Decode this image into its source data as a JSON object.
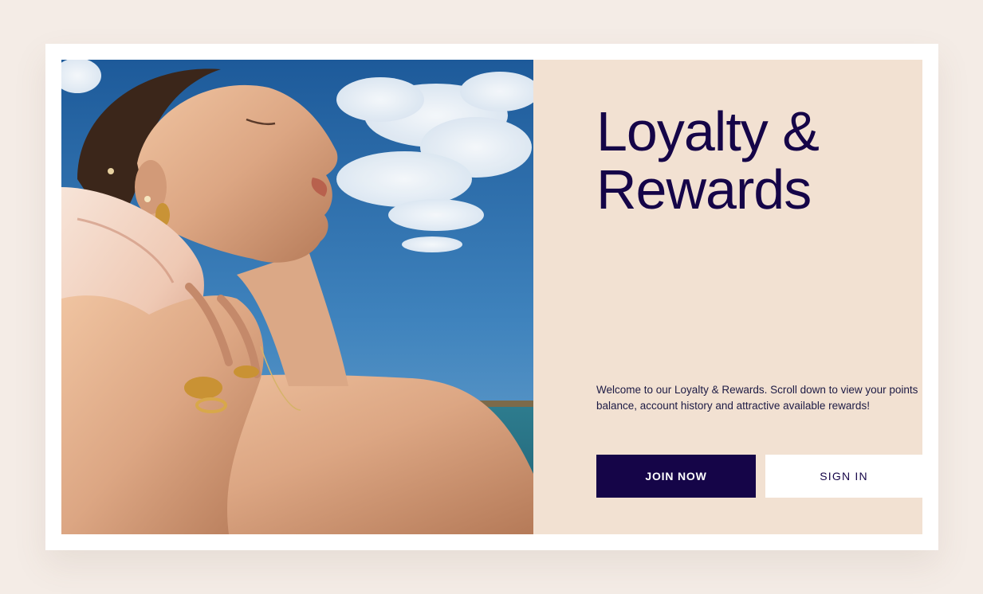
{
  "hero": {
    "title_line1": "Loyalty &",
    "title_line2": "Rewards",
    "intro": "Welcome to our Loyalty & Rewards. Scroll down to view your points balance, account history and attractive available rewards!",
    "join_label": "JOIN NOW",
    "sign_in_label": "SIGN IN",
    "image_description_icon": "woman-holding-seashell-photo"
  },
  "colors": {
    "page_bg": "#f4ece6",
    "panel_bg": "#f2e1d2",
    "brand_navy": "#150548",
    "sky": "#3a79b8",
    "skin": "#e2b08e"
  }
}
